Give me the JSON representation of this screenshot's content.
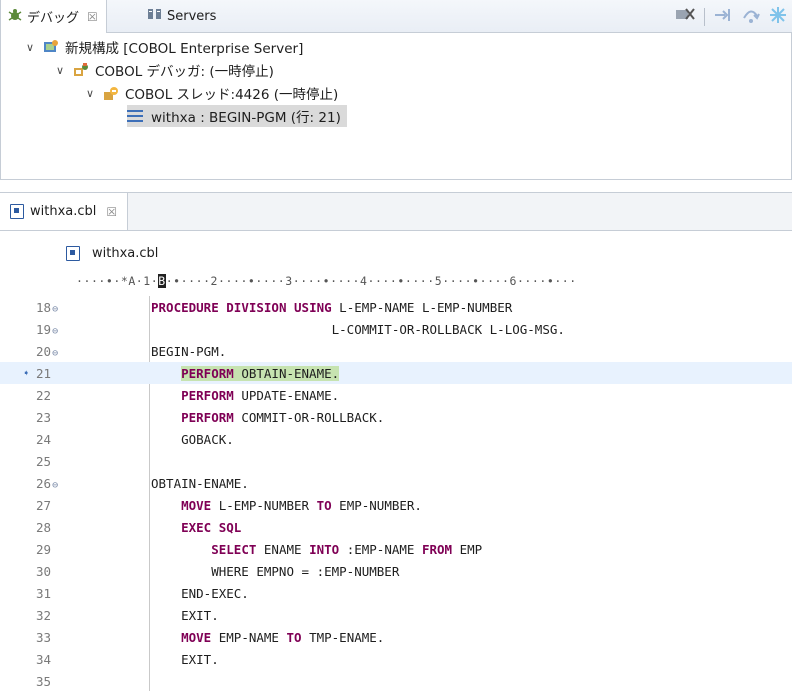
{
  "debug_view": {
    "tabs": [
      {
        "icon": "debug-icon",
        "label": "デバッグ",
        "close": "☒"
      },
      {
        "icon": "servers-icon",
        "label": "Servers"
      }
    ],
    "toolbar_icons": [
      "remove-all-terminated-icon",
      "step-into-icon",
      "step-over-icon",
      "suspend-icon"
    ],
    "tree": [
      {
        "label": "新規構成 [COBOL Enterprise Server]",
        "icon": "launch-config-icon"
      },
      {
        "label": "COBOL デバッガ: (一時停止)",
        "icon": "debugger-icon"
      },
      {
        "label": "COBOL スレッド:4426 (一時停止)",
        "icon": "thread-icon"
      },
      {
        "label": "withxa : BEGIN-PGM (行: 21)",
        "icon": "stack-frame-icon"
      }
    ]
  },
  "editor": {
    "tab": {
      "label": "withxa.cbl",
      "close": "☒"
    },
    "breadcrumb": "withxa.cbl",
    "ruler": {
      "before": "····•·*A·1·",
      "cursor": "B",
      "after": "·•····2····•····3····•····4····•····5····•····6····•···"
    },
    "lines": [
      {
        "num": "18",
        "fold": "⊖",
        "text": "PROCEDURE DIVISION USING L-EMP-NAME L-EMP-NUMBER"
      },
      {
        "num": "19",
        "fold": "⊖",
        "text": "                        L-COMMIT-OR-ROLLBACK L-LOG-MSG."
      },
      {
        "num": "20",
        "fold": "⊖",
        "text": "BEGIN-PGM."
      },
      {
        "num": "21",
        "fold": "",
        "marker": "➧",
        "current": true,
        "text": "    PERFORM OBTAIN-ENAME."
      },
      {
        "num": "22",
        "fold": "",
        "text": "    PERFORM UPDATE-ENAME."
      },
      {
        "num": "23",
        "fold": "",
        "text": "    PERFORM COMMIT-OR-ROLLBACK."
      },
      {
        "num": "24",
        "fold": "",
        "text": "    GOBACK."
      },
      {
        "num": "25",
        "fold": "",
        "text": ""
      },
      {
        "num": "26",
        "fold": "⊖",
        "text": "OBTAIN-ENAME."
      },
      {
        "num": "27",
        "fold": "",
        "text": "    MOVE L-EMP-NUMBER TO EMP-NUMBER."
      },
      {
        "num": "28",
        "fold": "",
        "text": "    EXEC SQL"
      },
      {
        "num": "29",
        "fold": "",
        "text": "        SELECT ENAME INTO :EMP-NAME FROM EMP"
      },
      {
        "num": "30",
        "fold": "",
        "text": "        WHERE EMPNO = :EMP-NUMBER"
      },
      {
        "num": "31",
        "fold": "",
        "text": "    END-EXEC."
      },
      {
        "num": "32",
        "fold": "",
        "text": "    EXIT."
      },
      {
        "num": "33",
        "fold": "",
        "text": "    MOVE EMP-NAME TO TMP-ENAME."
      },
      {
        "num": "34",
        "fold": "",
        "text": "    EXIT."
      },
      {
        "num": "35",
        "fold": "",
        "text": ""
      }
    ],
    "keywords": [
      "PROCEDURE",
      "DIVISION",
      "USING",
      "PERFORM",
      "GOBACK",
      "MOVE",
      "TO",
      "EXEC",
      "SQL",
      "SELECT",
      "INTO",
      "FROM",
      "EXIT"
    ],
    "colors": {
      "keyword": "#7f0055",
      "current_line": "#e8f2fe",
      "highlight": "#c6e3b0"
    }
  }
}
